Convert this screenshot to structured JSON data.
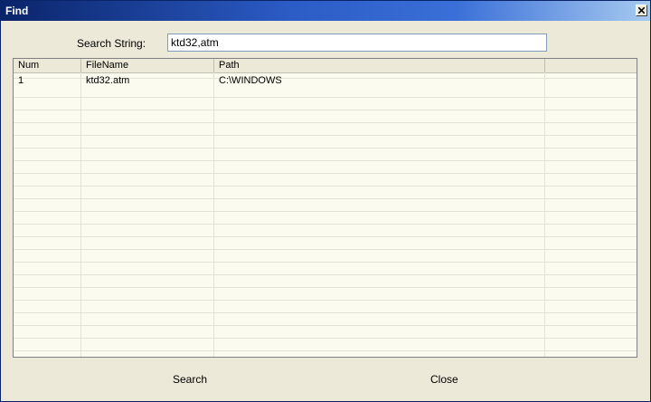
{
  "window": {
    "title": "Find",
    "close_icon": "close-icon"
  },
  "search": {
    "label": "Search String:",
    "value": "ktd32,atm"
  },
  "table": {
    "columns": [
      "Num",
      "FileName",
      "Path",
      ""
    ],
    "rows": [
      {
        "num": "1",
        "filename": "ktd32.atm",
        "path": "C:\\WINDOWS"
      }
    ]
  },
  "buttons": {
    "search_label": "Search",
    "close_label": "Close"
  },
  "colors": {
    "titlebar_start": "#0a246a",
    "titlebar_end": "#a6caf0",
    "dialog_background": "#ece9d8",
    "list_background": "#fbfbf0"
  }
}
